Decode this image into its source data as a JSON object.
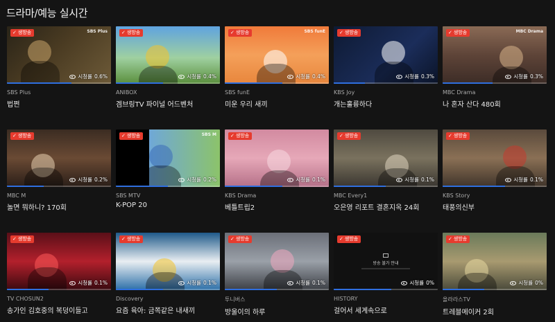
{
  "page": {
    "title": "드라마/예능 실시간"
  },
  "live_label": "생방송",
  "rating_label": "시청률",
  "cards": [
    {
      "channel": "SBS Plus",
      "program": "법쩐",
      "rating": "0.6%",
      "progress": 0.62,
      "logo": "SBS Plus",
      "bg": "linear-gradient(135deg,#2a2418 0%,#4a3b22 45%,#6d5a38 100%)",
      "accent": "#c9a46a"
    },
    {
      "channel": "ANIBOX",
      "program": "겜브링TV 파이널 어드벤처",
      "rating": "0.4%",
      "progress": 0.45,
      "logo": "",
      "bg": "linear-gradient(180deg,#5fa3e0 0%,#9fd0a0 55%,#5a8f3c 100%)",
      "accent": "#f2c12e"
    },
    {
      "channel": "SBS funE",
      "program": "미운 우리 새끼",
      "rating": "0.4%",
      "progress": 0.55,
      "logo": "SBS funE",
      "bg": "linear-gradient(180deg,#f07a3a 0%,#f4a05a 50%,#e8863c 100%)",
      "accent": "#ffffff"
    },
    {
      "channel": "KBS Joy",
      "program": "개는훌륭하다",
      "rating": "0.3%",
      "progress": 0.3,
      "logo": "",
      "bg": "linear-gradient(135deg,#0e1a33 0%,#1b2d5a 60%,#0b1428 100%)",
      "accent": "#ffffff"
    },
    {
      "channel": "MBC Drama",
      "program": "나 혼자 산다 480회",
      "rating": "0.3%",
      "progress": 0.48,
      "logo": "MBC Drama",
      "bg": "linear-gradient(180deg,#8a6a55 0%,#5e4438 50%,#3c2c26 100%)",
      "accent": "#d9b48a"
    },
    {
      "channel": "MBC M",
      "program": "놀면 뭐하니? 170회",
      "rating": "0.2%",
      "progress": 0.35,
      "logo": "",
      "bg": "linear-gradient(180deg,#3b2c22 0%,#6a4a34 50%,#2a1e18 100%)",
      "accent": "#e8d0b0"
    },
    {
      "channel": "SBS MTV",
      "program": "K-POP 20",
      "rating": "0.2%",
      "progress": 0.5,
      "logo": "SBS M",
      "bg": "linear-gradient(90deg,#000 0%,#000 32%,#6fa8d8 32%,#8cc36a 100%)",
      "accent": "#3b6bb8"
    },
    {
      "channel": "KBS Drama",
      "program": "베틀트립2",
      "rating": "0.1%",
      "progress": 0.55,
      "logo": "",
      "bg": "linear-gradient(180deg,#d28aa0 0%,#e6a8b8 50%,#b57088 100%)",
      "accent": "#f8d8e0"
    },
    {
      "channel": "MBC Every1",
      "program": "오은영 리포트 결혼지옥 24회",
      "rating": "0.1%",
      "progress": 0.5,
      "logo": "",
      "bg": "linear-gradient(180deg,#4f4a40 0%,#7a725e 50%,#3a3630 100%)",
      "accent": "#e0d6c0"
    },
    {
      "channel": "KBS Story",
      "program": "태풍의신부",
      "rating": "0.1%",
      "progress": 0.6,
      "logo": "",
      "bg": "linear-gradient(180deg,#5a4a3c 0%,#8a7055 50%,#40342a 100%)",
      "accent": "#c43a2e"
    },
    {
      "channel": "TV CHOSUN2",
      "program": "송가인 김호중의 복덩이들고",
      "rating": "0.1%",
      "progress": 0.4,
      "logo": "",
      "bg": "linear-gradient(180deg,#5a0f18 0%,#b3202c 50%,#3a0a10 100%)",
      "accent": "#ff5a5a"
    },
    {
      "channel": "Discovery",
      "program": "요즘 육아: 금쪽같은 내새끼",
      "rating": "0.1%",
      "progress": 0.45,
      "logo": "",
      "bg": "linear-gradient(180deg,#1f5a8a 0%,#e9eef2 50%,#2c6fa8 100%)",
      "accent": "#f4c22b"
    },
    {
      "channel": "투니버스",
      "program": "방울이의 하루",
      "rating": "0.1%",
      "progress": 0.5,
      "logo": "",
      "bg": "linear-gradient(180deg,#6b6f78 0%,#9aa0a8 50%,#3c3f45 100%)",
      "accent": "#f0a8c0"
    },
    {
      "channel": "HISTORY",
      "program": "걸어서 세계속으로",
      "rating": "0%",
      "progress": 0.55,
      "logo": "",
      "unavailable": true,
      "unavailable_text": "방송 불가 안내",
      "bg": "#0e0e0e",
      "accent": "#ffffff"
    },
    {
      "channel": "올라라스TV",
      "program": "트레블메이커 2회",
      "rating": "0%",
      "progress": 0.4,
      "logo": "",
      "bg": "linear-gradient(180deg,#6a7a5a 0%,#a89a70 50%,#4a4a3a 100%)",
      "accent": "#e8d8a0"
    }
  ]
}
